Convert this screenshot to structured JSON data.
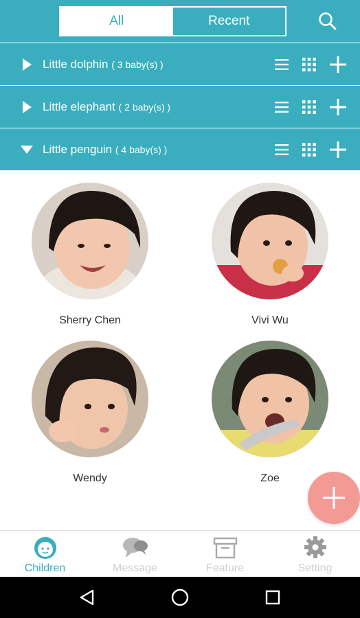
{
  "colors": {
    "accent": "#3aaebe",
    "fab": "#f39a94",
    "inactive_nav": "#cfcfcf",
    "system_bar": "#000000"
  },
  "filter": {
    "all_label": "All",
    "recent_label": "Recent",
    "selected": "All"
  },
  "search_icon": "search-icon",
  "groups": [
    {
      "name": "Little dolphin",
      "count": "( 3 baby(s) )",
      "expanded": false
    },
    {
      "name": "Little elephant",
      "count": "( 2 baby(s) )",
      "expanded": false
    },
    {
      "name": "Little penguin",
      "count": "( 4 baby(s) )",
      "expanded": true
    }
  ],
  "babies": [
    {
      "name": "Sherry Chen"
    },
    {
      "name": "Vivi Wu"
    },
    {
      "name": "Wendy"
    },
    {
      "name": "Zoe"
    }
  ],
  "bottom_nav": [
    {
      "label": "Children",
      "icon": "child-face-icon",
      "active": true
    },
    {
      "label": "Message",
      "icon": "chat-bubbles-icon",
      "active": false
    },
    {
      "label": "Feature",
      "icon": "archive-box-icon",
      "active": false
    },
    {
      "label": "Setting",
      "icon": "gear-icon",
      "active": false
    }
  ],
  "system_nav": [
    "back-icon",
    "home-icon",
    "recents-icon"
  ]
}
